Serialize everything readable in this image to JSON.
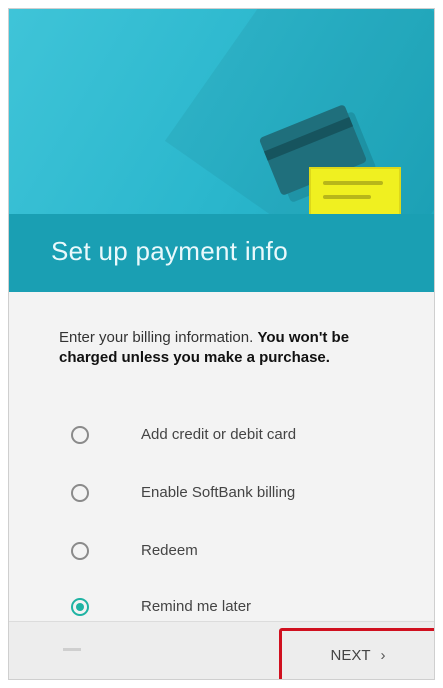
{
  "dialog": {
    "title": "Set up payment info",
    "intro_text": "Enter your billing information.",
    "intro_bold": "You won't be charged unless you make a purchase."
  },
  "options": [
    {
      "label": "Add credit or debit card",
      "checked": false
    },
    {
      "label": "Enable SoftBank billing",
      "checked": false
    },
    {
      "label": "Redeem",
      "checked": false
    },
    {
      "label": "Remind me later",
      "checked": true
    }
  ],
  "footer": {
    "next_label": "NEXT",
    "next_icon": "chevron-right-icon",
    "next_glyph": "›"
  },
  "colors": {
    "header_teal": "#2bb7cd",
    "title_bar": "#1a9fb3",
    "radio_accent": "#1fb3a3",
    "highlight_box": "#d0101f",
    "note_yellow": "#f0f020"
  }
}
